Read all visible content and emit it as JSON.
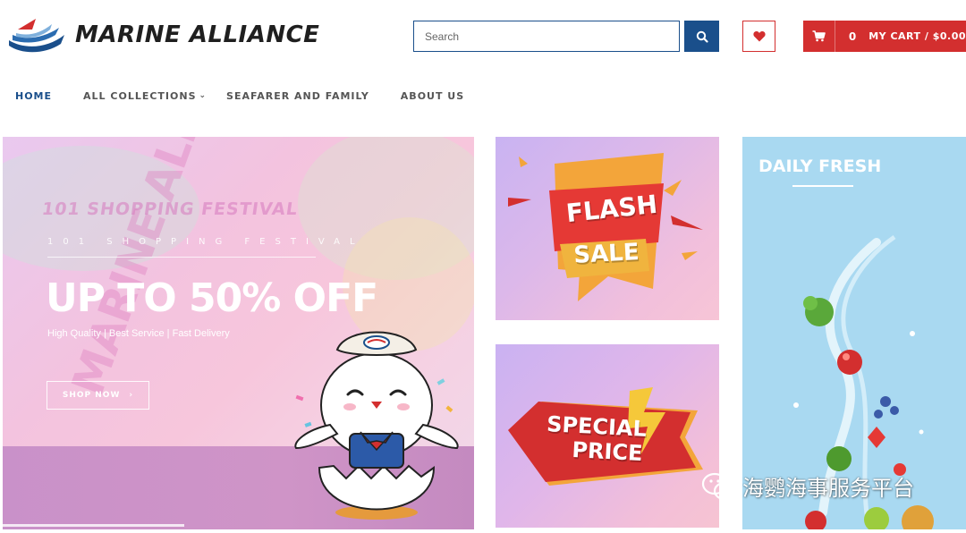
{
  "header": {
    "brand_name": "MARINE ALLIANCE",
    "search": {
      "placeholder": "Search",
      "value": ""
    },
    "search_icon": "search-icon",
    "wishlist_icon": "heart-icon",
    "cart": {
      "count": "0",
      "label": "MY CART / $0.00",
      "icon": "cart-icon"
    }
  },
  "nav": {
    "items": [
      {
        "label": "HOME",
        "active": true
      },
      {
        "label": "ALL COLLECTIONS",
        "has_dropdown": true
      },
      {
        "label": "SEAFARER AND FAMILY"
      },
      {
        "label": "ABOUT US"
      }
    ]
  },
  "banners": {
    "hero": {
      "bg_title": "101 SHOPPING FESTIVAL",
      "bg_brand": "MARINE ALLIANCE",
      "spaced_title": "101 SHOPPING FESTIVAL",
      "headline": "UP TO 50% OFF",
      "subline": "High Quality | Best Service | Fast Delivery",
      "cta": "SHOP NOW"
    },
    "flash_sale": {
      "line1": "FLASH",
      "line2": "SALE"
    },
    "special_price": {
      "line1": "SPECIAL",
      "line2": "PRICE"
    },
    "daily_fresh": {
      "title": "DAILY FRESH"
    }
  },
  "watermark": {
    "text": "海鹦海事服务平台"
  },
  "colors": {
    "brand_blue": "#1a4f8b",
    "brand_red": "#d32f2f",
    "nav_text": "#555555",
    "fresh_bg": "#a9d9f1"
  }
}
